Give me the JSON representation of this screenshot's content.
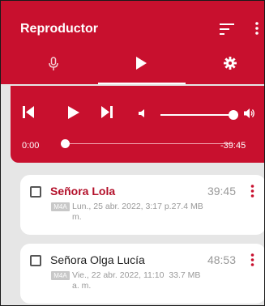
{
  "app": {
    "title": "Reproductor",
    "accent": "#c8102e"
  },
  "toolbar": {
    "sort_icon": "sort-icon",
    "more_icon": "more-vert-icon"
  },
  "tabs": [
    {
      "name": "tab-record",
      "icon": "mic-icon",
      "selected": false
    },
    {
      "name": "tab-player",
      "icon": "play-icon",
      "selected": true
    },
    {
      "name": "tab-settings",
      "icon": "gear-icon",
      "selected": false
    }
  ],
  "player": {
    "current_time": "0:00",
    "remaining_time": "-39:45",
    "seek_progress": 0,
    "volume_level": 1
  },
  "recordings": [
    {
      "name": "Señora Lola",
      "duration": "39:45",
      "format": "M4A",
      "date_line": "Lun., 25 abr. 2022, 3:17 p.",
      "size": "27.4 MB",
      "date_cont": "m.",
      "checked": false,
      "active": true
    },
    {
      "name": "Señora Olga Lucía",
      "duration": "48:53",
      "format": "M4A",
      "date_line": "Vie., 22 abr. 2022, 11:10",
      "size": "33.7 MB",
      "date_cont": "a. m.",
      "checked": false,
      "active": false
    }
  ]
}
